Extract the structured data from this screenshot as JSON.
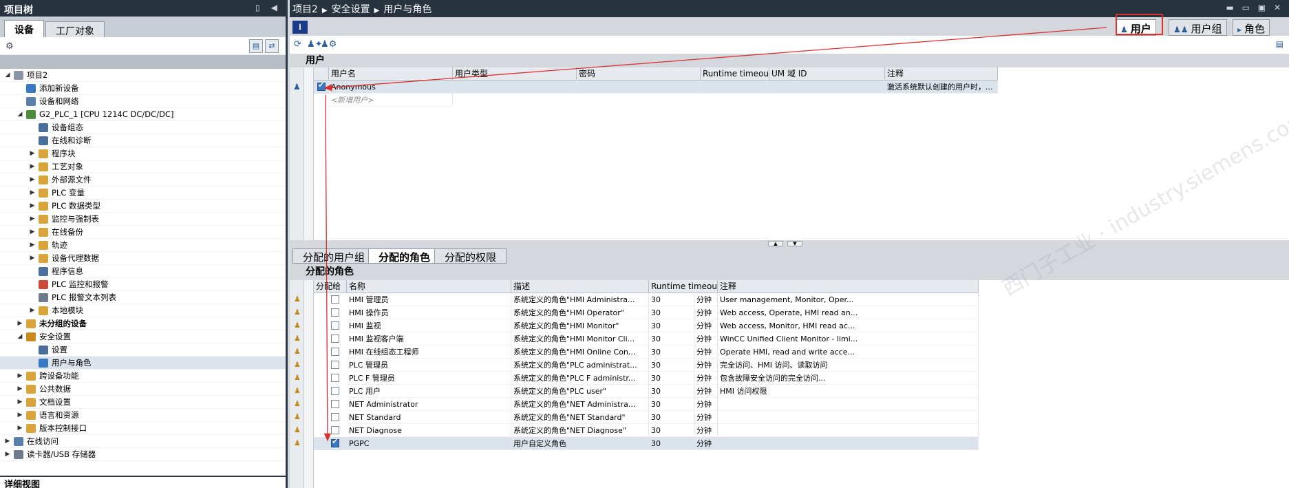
{
  "left_panel": {
    "title": "项目树",
    "tabs": [
      {
        "label": "设备",
        "active": true
      },
      {
        "label": "工厂对象",
        "active": false
      }
    ],
    "tree": [
      {
        "label": "项目2",
        "level": 0,
        "arrow": "down",
        "bold": false,
        "icon": "project-icon"
      },
      {
        "label": "添加新设备",
        "level": 1,
        "arrow": "",
        "bold": false,
        "icon": "add-device-icon"
      },
      {
        "label": "设备和网络",
        "level": 1,
        "arrow": "",
        "bold": false,
        "icon": "network-icon"
      },
      {
        "label": "G2_PLC_1 [CPU 1214C DC/DC/DC]",
        "level": 1,
        "arrow": "down",
        "bold": false,
        "icon": "plc-icon"
      },
      {
        "label": "设备组态",
        "level": 2,
        "arrow": "",
        "bold": false,
        "icon": "device-config-icon"
      },
      {
        "label": "在线和诊断",
        "level": 2,
        "arrow": "",
        "bold": false,
        "icon": "diagnostics-icon"
      },
      {
        "label": "程序块",
        "level": 2,
        "arrow": "right",
        "bold": false,
        "icon": "folder-icon"
      },
      {
        "label": "工艺对象",
        "level": 2,
        "arrow": "right",
        "bold": false,
        "icon": "folder-icon"
      },
      {
        "label": "外部源文件",
        "level": 2,
        "arrow": "right",
        "bold": false,
        "icon": "folder-icon"
      },
      {
        "label": "PLC 变量",
        "level": 2,
        "arrow": "right",
        "bold": false,
        "icon": "folder-icon"
      },
      {
        "label": "PLC 数据类型",
        "level": 2,
        "arrow": "right",
        "bold": false,
        "icon": "folder-icon"
      },
      {
        "label": "监控与强制表",
        "level": 2,
        "arrow": "right",
        "bold": false,
        "icon": "folder-icon"
      },
      {
        "label": "在线备份",
        "level": 2,
        "arrow": "right",
        "bold": false,
        "icon": "folder-icon"
      },
      {
        "label": "轨迹",
        "level": 2,
        "arrow": "right",
        "bold": false,
        "icon": "folder-icon"
      },
      {
        "label": "设备代理数据",
        "level": 2,
        "arrow": "right",
        "bold": false,
        "icon": "folder-icon"
      },
      {
        "label": "程序信息",
        "level": 2,
        "arrow": "",
        "bold": false,
        "icon": "info-icon"
      },
      {
        "label": "PLC 监控和报警",
        "level": 2,
        "arrow": "",
        "bold": false,
        "icon": "alarm-icon"
      },
      {
        "label": "PLC 报警文本列表",
        "level": 2,
        "arrow": "",
        "bold": false,
        "icon": "text-list-icon"
      },
      {
        "label": "本地模块",
        "level": 2,
        "arrow": "right",
        "bold": false,
        "icon": "folder-icon"
      },
      {
        "label": "未分组的设备",
        "level": 1,
        "arrow": "right",
        "bold": true,
        "icon": "folder-icon"
      },
      {
        "label": "安全设置",
        "level": 1,
        "arrow": "down",
        "bold": false,
        "icon": "security-icon"
      },
      {
        "label": "设置",
        "level": 2,
        "arrow": "",
        "bold": false,
        "icon": "settings-icon"
      },
      {
        "label": "用户与角色",
        "level": 2,
        "arrow": "",
        "bold": false,
        "icon": "users-icon",
        "selected": true
      },
      {
        "label": "跨设备功能",
        "level": 1,
        "arrow": "right",
        "bold": false,
        "icon": "folder-icon"
      },
      {
        "label": "公共数据",
        "level": 1,
        "arrow": "right",
        "bold": false,
        "icon": "folder-icon"
      },
      {
        "label": "文档设置",
        "level": 1,
        "arrow": "right",
        "bold": false,
        "icon": "folder-icon"
      },
      {
        "label": "语言和资源",
        "level": 1,
        "arrow": "right",
        "bold": false,
        "icon": "folder-icon"
      },
      {
        "label": "版本控制接口",
        "level": 1,
        "arrow": "right",
        "bold": false,
        "icon": "folder-icon"
      },
      {
        "label": "在线访问",
        "level": 0,
        "arrow": "right",
        "bold": false,
        "icon": "online-icon"
      },
      {
        "label": "读卡器/USB 存储器",
        "level": 0,
        "arrow": "right",
        "bold": false,
        "icon": "card-reader-icon"
      }
    ],
    "detail_view": "详细视图"
  },
  "breadcrumb": [
    "项目2",
    "安全设置",
    "用户与角色"
  ],
  "info_label": "i",
  "top_tabs": [
    {
      "label": "用户",
      "icon": "user-icon",
      "active": true
    },
    {
      "label": "用户组",
      "icon": "user-group-icon",
      "active": false
    },
    {
      "label": "角色",
      "icon": "role-icon",
      "active": false
    }
  ],
  "users_section": {
    "title": "用户",
    "columns": [
      "用户名",
      "用户类型",
      "密码",
      "Runtime timeout",
      "UM 域 ID",
      "注释"
    ],
    "rows": [
      {
        "name": "Anonymous",
        "type": "",
        "password": "",
        "timeout": "",
        "um_id": "",
        "comment": "激活系统默认创建的用户时，...",
        "checked": true
      }
    ],
    "add_placeholder": "<新增用户>"
  },
  "bottom_tabs": [
    {
      "label": "分配的用户组",
      "active": false
    },
    {
      "label": "分配的角色",
      "active": true
    },
    {
      "label": "分配的权限",
      "active": false
    }
  ],
  "roles_section": {
    "title": "分配的角色",
    "columns": [
      "分配给",
      "名称",
      "描述",
      "Runtime timeout",
      "注释"
    ],
    "rows": [
      {
        "checked": false,
        "name": "HMI 管理员",
        "desc": "系统定义的角色\"HMI Administra...",
        "timeout": "30",
        "unit": "分钟",
        "comment": "User management, Monitor, Oper..."
      },
      {
        "checked": false,
        "name": "HMI 操作员",
        "desc": "系统定义的角色\"HMI Operator\"",
        "timeout": "30",
        "unit": "分钟",
        "comment": "Web access, Operate, HMI read an..."
      },
      {
        "checked": false,
        "name": "HMI 监视",
        "desc": "系统定义的角色\"HMI Monitor\"",
        "timeout": "30",
        "unit": "分钟",
        "comment": "Web access, Monitor, HMI read ac..."
      },
      {
        "checked": false,
        "name": "HMI 监视客户端",
        "desc": "系统定义的角色\"HMI Monitor Cli...",
        "timeout": "30",
        "unit": "分钟",
        "comment": "WinCC Unified Client Monitor - limi..."
      },
      {
        "checked": false,
        "name": "HMI 在线组态工程师",
        "desc": "系统定义的角色\"HMI Online Con...",
        "timeout": "30",
        "unit": "分钟",
        "comment": "Operate HMI, read and write acce..."
      },
      {
        "checked": false,
        "name": "PLC 管理员",
        "desc": "系统定义的角色\"PLC administrat...",
        "timeout": "30",
        "unit": "分钟",
        "comment": "完全访问、HMI 访问、读取访问"
      },
      {
        "checked": false,
        "name": "PLC F 管理员",
        "desc": "系统定义的角色\"PLC F administr...",
        "timeout": "30",
        "unit": "分钟",
        "comment": "包含故障安全访问的完全访问..."
      },
      {
        "checked": false,
        "name": "PLC 用户",
        "desc": "系统定义的角色\"PLC user\"",
        "timeout": "30",
        "unit": "分钟",
        "comment": "HMI 访问权限"
      },
      {
        "checked": false,
        "name": "NET Administrator",
        "desc": "系统定义的角色\"NET Administra...",
        "timeout": "30",
        "unit": "分钟",
        "comment": ""
      },
      {
        "checked": false,
        "name": "NET Standard",
        "desc": "系统定义的角色\"NET Standard\"",
        "timeout": "30",
        "unit": "分钟",
        "comment": ""
      },
      {
        "checked": false,
        "name": "NET Diagnose",
        "desc": "系统定义的角色\"NET Diagnose\"",
        "timeout": "30",
        "unit": "分钟",
        "comment": ""
      },
      {
        "checked": true,
        "name": "PGPC",
        "desc": "用户自定义角色",
        "timeout": "30",
        "unit": "分钟",
        "comment": ""
      }
    ]
  },
  "colors": {
    "title_bar": "#27333f",
    "annotation": "#d93030",
    "accent": "#3b78c4"
  }
}
